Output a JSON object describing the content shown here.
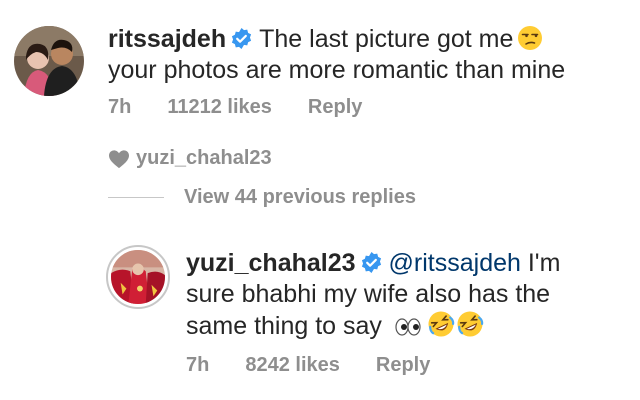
{
  "comment": {
    "username": "ritssajdeh",
    "text_line1": "The last picture got me",
    "emoji": "unamused-face-emoji",
    "text_line2": "your photos are more romantic than mine",
    "time": "7h",
    "likes": "11212 likes",
    "reply_label": "Reply"
  },
  "liked_by": {
    "icon": "heart-icon",
    "username": "yuzi_chahal23"
  },
  "view_replies": {
    "label": "View 44 previous replies"
  },
  "reply": {
    "username": "yuzi_chahal23",
    "mention": "@ritssajdeh",
    "text_part1": "I'm",
    "text_line2": "sure bhabhi my wife also has the",
    "text_line3": "same thing to say",
    "emojis": [
      "eyes-emoji",
      "rofl-emoji",
      "rofl-emoji"
    ],
    "time": "7h",
    "likes": "8242 likes",
    "reply_label": "Reply"
  },
  "colors": {
    "text": "#262626",
    "secondary": "#8e8e8e",
    "verified_blue": "#3897f0",
    "mention": "#00376b",
    "story_ring": "#c7c7c7"
  }
}
